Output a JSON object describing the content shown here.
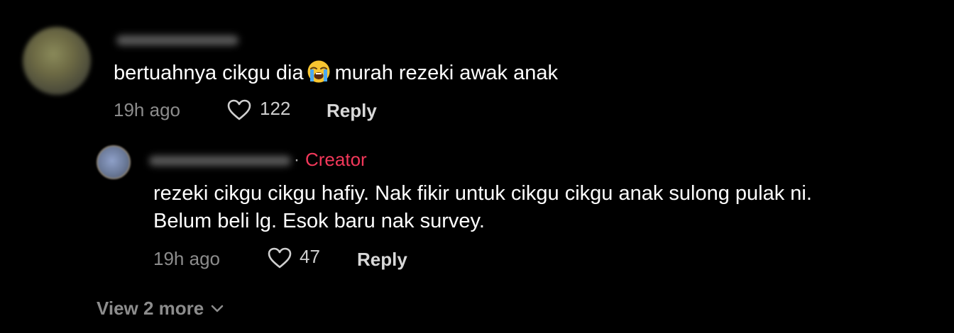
{
  "comment": {
    "text_before_emoji": "bertuahnya cikgu dia",
    "emoji": "loudly-crying-face",
    "text_after_emoji": "murah rezeki awak anak",
    "time": "19h ago",
    "likes": "122",
    "reply_label": "Reply"
  },
  "reply": {
    "badge": "Creator",
    "separator": "·",
    "text_line1": "rezeki cikgu cikgu hafiy. Nak fikir untuk cikgu cikgu anak sulong pulak ni.",
    "text_line2": "Belum beli lg. Esok baru nak survey.",
    "time": "19h ago",
    "likes": "47",
    "reply_label": "Reply"
  },
  "view_more": {
    "label": "View 2 more"
  },
  "colors": {
    "background": "#000000",
    "creator_badge": "#f2385a",
    "secondary_text": "#8c8c8c",
    "primary_text": "#ffffff"
  },
  "icons": {
    "like": "heart-outline-icon",
    "expand": "chevron-down-icon"
  }
}
